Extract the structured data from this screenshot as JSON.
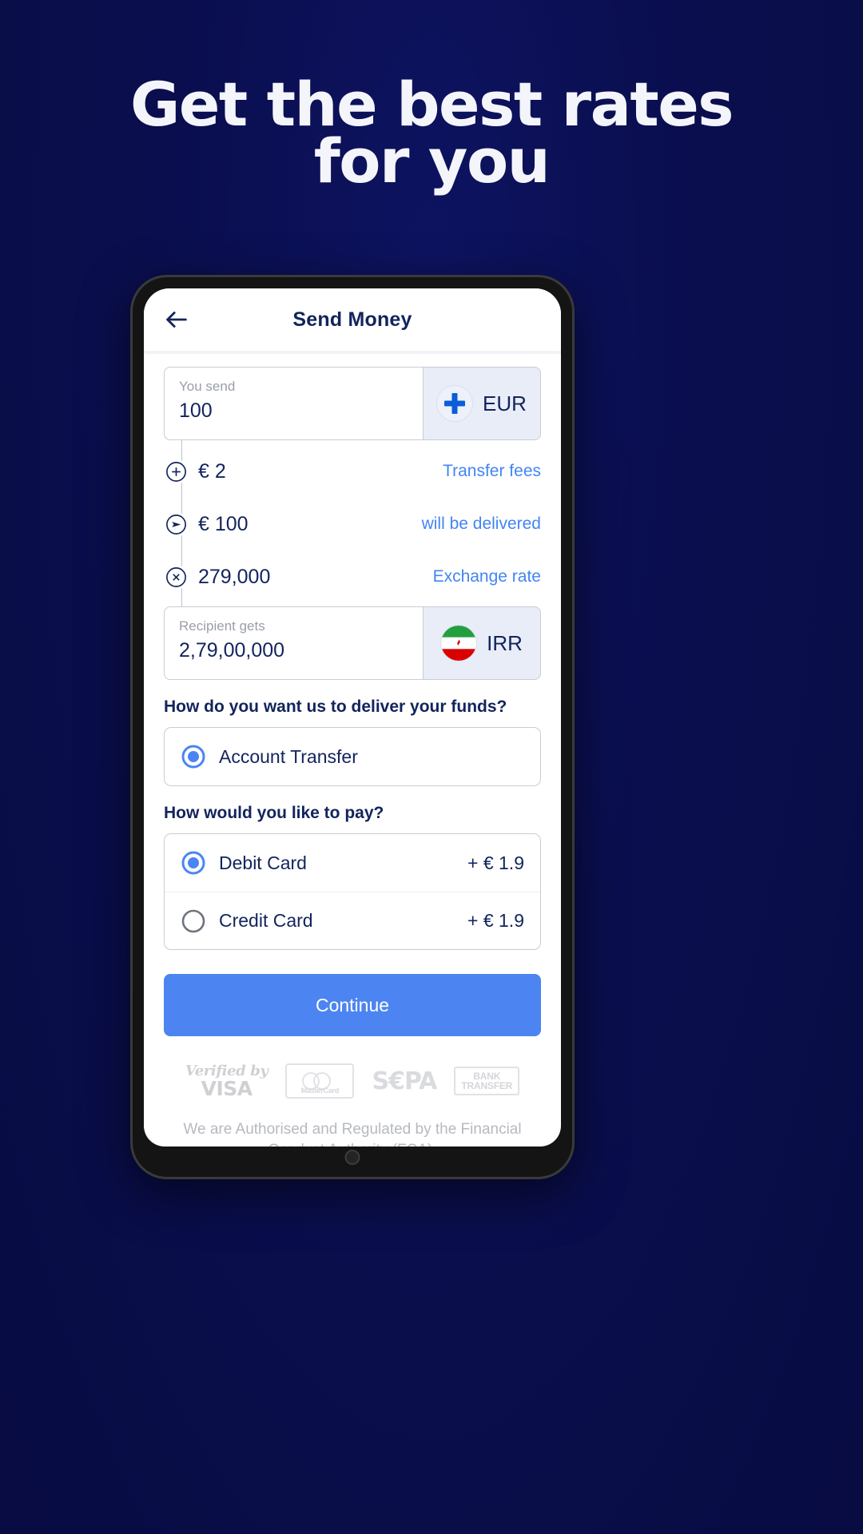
{
  "hero": {
    "line1": "Get the best rates",
    "line2": "for you",
    "background_color": "#0b0f52",
    "text_color": "#f4f5fa"
  },
  "app": {
    "appbar": {
      "back_icon": "arrow-left-icon",
      "title": "Send Money"
    },
    "send_field": {
      "label": "You send",
      "value": "100",
      "currency_code": "EUR",
      "currency_flag": "eu-flag-icon"
    },
    "breakdown": [
      {
        "icon": "plus-circle-icon",
        "amount": "€ 2",
        "note": "Transfer fees"
      },
      {
        "icon": "send-circle-icon",
        "amount": "€ 100",
        "note": "will be delivered"
      },
      {
        "icon": "multiply-circle-icon",
        "amount": "279,000",
        "note": "Exchange rate"
      }
    ],
    "receive_field": {
      "label": "Recipient gets",
      "value": "2,79,00,000",
      "currency_code": "IRR",
      "currency_flag": "iran-flag-icon"
    },
    "delivery": {
      "question": "How do you want us to deliver your funds?",
      "options": [
        {
          "label": "Account Transfer",
          "selected": true,
          "fee": ""
        }
      ]
    },
    "payment": {
      "question": "How would you like to pay?",
      "options": [
        {
          "label": "Debit Card",
          "selected": true,
          "fee": "+ € 1.9"
        },
        {
          "label": "Credit Card",
          "selected": false,
          "fee": "+ € 1.9"
        }
      ]
    },
    "continue_label": "Continue",
    "trust_logos": [
      {
        "name": "visa-logo",
        "line1": "Verified by",
        "line2": "VISA"
      },
      {
        "name": "mastercard-logo",
        "line1": "MasterCard",
        "line2": ""
      },
      {
        "name": "sepa-logo",
        "line1": "S€PA",
        "line2": ""
      },
      {
        "name": "bank-transfer-logo",
        "line1": "BANK",
        "line2": "TRANSFER"
      }
    ],
    "disclaimer": "We are Authorised and Regulated by the Financial Conduct Authority (FCA).",
    "accent_color": "#4c85f2",
    "navy_color": "#12245c"
  }
}
